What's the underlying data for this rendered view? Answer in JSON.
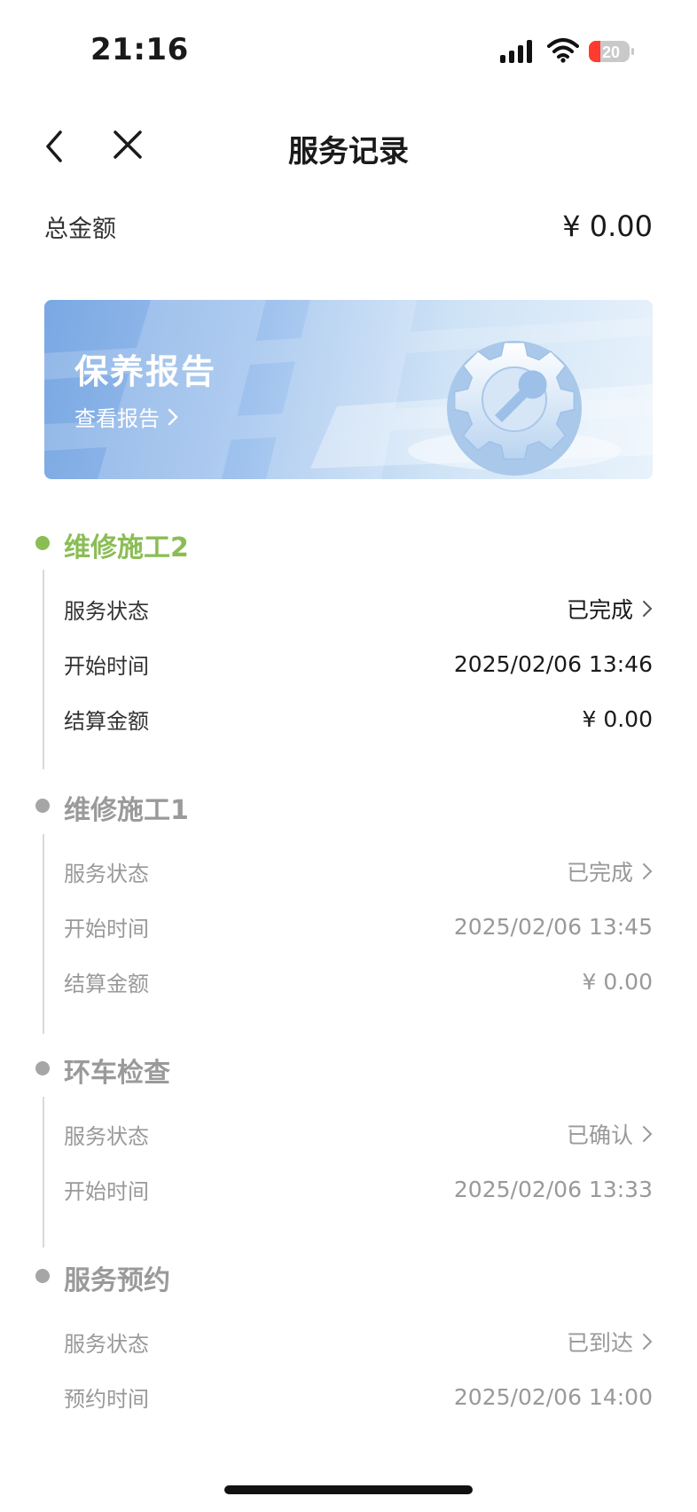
{
  "status_bar": {
    "time": "21:16",
    "battery": "20"
  },
  "nav": {
    "title": "服务记录"
  },
  "total": {
    "label": "总金额",
    "value": "¥ 0.00"
  },
  "banner": {
    "title": "保养报告",
    "link": "查看报告"
  },
  "sections": [
    {
      "title": "维修施工2",
      "rows": [
        {
          "label": "服务状态",
          "value": "已完成"
        },
        {
          "label": "开始时间",
          "value": "2025/02/06 13:46"
        },
        {
          "label": "结算金额",
          "value": "¥  0.00"
        }
      ]
    },
    {
      "title": "维修施工1",
      "rows": [
        {
          "label": "服务状态",
          "value": "已完成"
        },
        {
          "label": "开始时间",
          "value": "2025/02/06 13:45"
        },
        {
          "label": "结算金额",
          "value": "¥  0.00"
        }
      ]
    },
    {
      "title": "环车检查",
      "rows": [
        {
          "label": "服务状态",
          "value": "已确认"
        },
        {
          "label": "开始时间",
          "value": "2025/02/06 13:33"
        }
      ]
    },
    {
      "title": "服务预约",
      "rows": [
        {
          "label": "服务状态",
          "value": "已到达"
        },
        {
          "label": "预约时间",
          "value": "2025/02/06 14:00"
        }
      ]
    }
  ],
  "colors": {
    "accent_green": "#8bbd55",
    "muted_gray": "#999999",
    "timeline_line": "#d9d9d9"
  },
  "icons": [
    "back-arrow-icon",
    "close-icon",
    "signal-icon",
    "wifi-icon",
    "battery-icon",
    "chevron-right-icon",
    "gear-icon"
  ]
}
